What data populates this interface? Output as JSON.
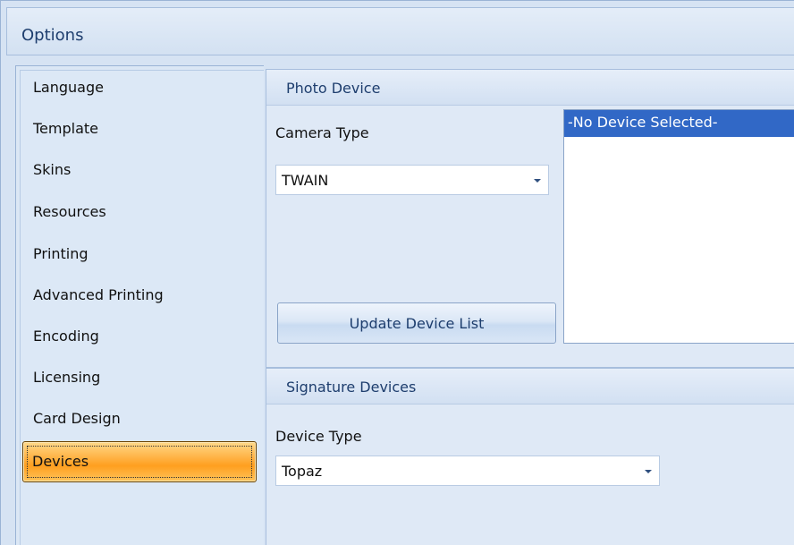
{
  "window": {
    "title": "Options"
  },
  "nav": {
    "items": [
      {
        "label": "Language"
      },
      {
        "label": "Template"
      },
      {
        "label": "Skins"
      },
      {
        "label": "Resources"
      },
      {
        "label": "Printing"
      },
      {
        "label": "Advanced Printing"
      },
      {
        "label": "Encoding"
      },
      {
        "label": "Licensing"
      },
      {
        "label": "Card Design"
      },
      {
        "label": "Devices",
        "selected": true
      }
    ]
  },
  "photo_device": {
    "header": "Photo Device",
    "camera_type_label": "Camera Type",
    "camera_type_value": "TWAIN",
    "devices": [
      "-No Device Selected-"
    ],
    "update_button": "Update Device List"
  },
  "signature_devices": {
    "header": "Signature Devices",
    "device_type_label": "Device Type",
    "device_type_value": "Topaz"
  },
  "colors": {
    "selection_orange": "#ff9f1f",
    "list_selection_blue": "#3168c6",
    "header_text": "#1e3e6e"
  }
}
